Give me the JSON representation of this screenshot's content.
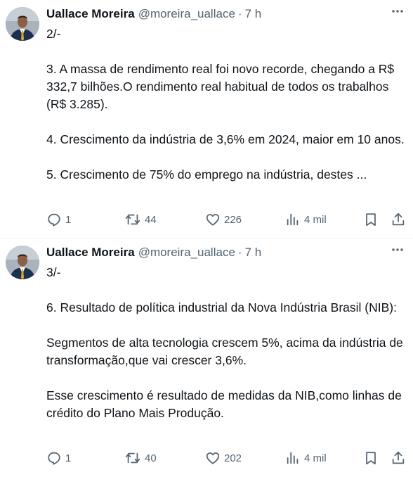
{
  "tweets": [
    {
      "author_name": "Uallace Moreira",
      "handle": "@moreira_uallace",
      "separator": "·",
      "time": "7 h",
      "paragraphs": [
        "2/-",
        "3. A massa de rendimento real foi novo recorde, chegando a R$ 332,7 bilhões.O rendimento real habitual de todos os trabalhos (R$ 3.285).",
        "4. Crescimento da indústria de 3,6% em 2024, maior em 10 anos.",
        "5. Crescimento de 75% do emprego na indústria, destes ..."
      ],
      "replies": "1",
      "retweets": "44",
      "likes": "226",
      "views": "4 mil"
    },
    {
      "author_name": "Uallace Moreira",
      "handle": "@moreira_uallace",
      "separator": "·",
      "time": "7 h",
      "paragraphs": [
        "3/-",
        "6. Resultado de política industrial da Nova Indústria Brasil (NIB):",
        "Segmentos de alta tecnologia crescem 5%, acima da indústria de transformação,que vai crescer 3,6%.",
        "Esse crescimento é resultado de medidas da NIB,como linhas de crédito do Plano Mais Produção."
      ],
      "replies": "1",
      "retweets": "40",
      "likes": "202",
      "views": "4 mil"
    }
  ],
  "icons": {
    "reply": "reply-icon",
    "retweet": "retweet-icon",
    "like": "heart-icon",
    "views": "views-icon",
    "bookmark": "bookmark-icon",
    "share": "share-icon",
    "more": "more-icon"
  },
  "colors": {
    "text": "#0f1419",
    "secondary": "#536471",
    "divider": "#eff3f4",
    "avatar_suit": "#1d2f4f",
    "avatar_tie": "#d9a92a"
  }
}
